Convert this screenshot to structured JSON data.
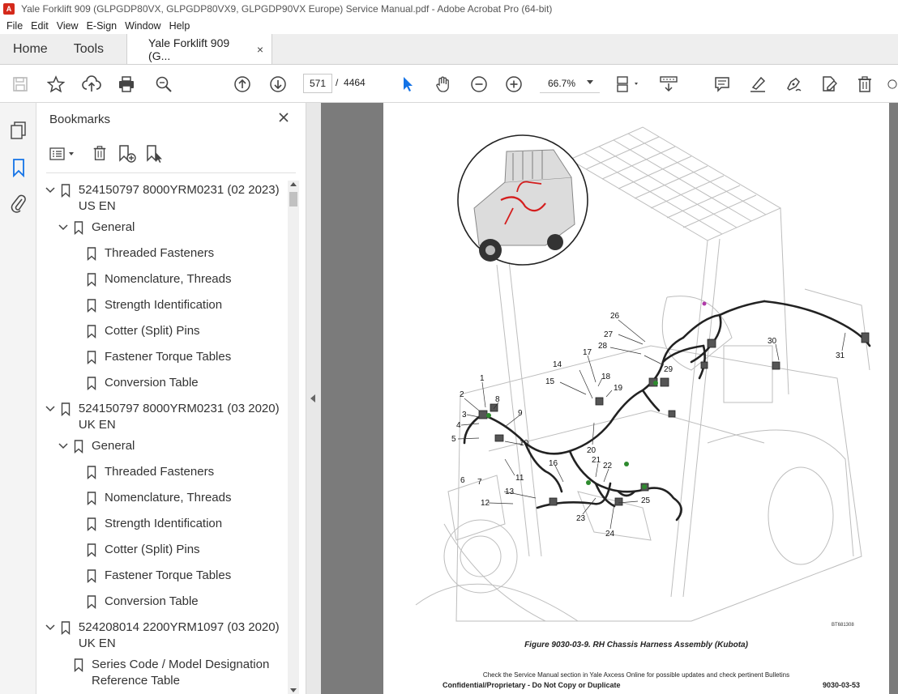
{
  "window": {
    "title": "Yale Forklift 909 (GLPGDP80VX, GLPGDP80VX9, GLPGDP90VX Europe) Service Manual.pdf - Adobe Acrobat Pro (64-bit)"
  },
  "menu": [
    "File",
    "Edit",
    "View",
    "E-Sign",
    "Window",
    "Help"
  ],
  "tabs": {
    "home": "Home",
    "tools": "Tools",
    "document": "Yale Forklift 909 (G...",
    "close": "×"
  },
  "toolbar": {
    "current_page": "571",
    "page_separator": "/",
    "total_pages": "4464",
    "zoom": "66.7%"
  },
  "bookmarks": {
    "title": "Bookmarks",
    "items": [
      {
        "label": "524150797 8000YRM0231 (02 2023) US EN",
        "level": 0,
        "expanded": true
      },
      {
        "label": "General",
        "level": 1,
        "expanded": true
      },
      {
        "label": "Threaded Fasteners",
        "level": 2
      },
      {
        "label": "Nomenclature, Threads",
        "level": 2
      },
      {
        "label": "Strength Identification",
        "level": 2
      },
      {
        "label": "Cotter (Split) Pins",
        "level": 2
      },
      {
        "label": "Fastener Torque Tables",
        "level": 2
      },
      {
        "label": "Conversion Table",
        "level": 2
      },
      {
        "label": "524150797 8000YRM0231 (03 2020) UK EN",
        "level": 0,
        "expanded": true
      },
      {
        "label": "General",
        "level": 1,
        "expanded": true
      },
      {
        "label": "Threaded Fasteners",
        "level": 2
      },
      {
        "label": "Nomenclature, Threads",
        "level": 2
      },
      {
        "label": "Strength Identification",
        "level": 2
      },
      {
        "label": "Cotter (Split) Pins",
        "level": 2
      },
      {
        "label": "Fastener Torque Tables",
        "level": 2
      },
      {
        "label": "Conversion Table",
        "level": 2
      },
      {
        "label": "524208014 2200YRM1097 (03 2020) UK EN",
        "level": 0,
        "expanded": true
      },
      {
        "label": "Series Code / Model Designation Reference Table",
        "level": 1
      }
    ]
  },
  "document_page": {
    "figure_caption": "Figure 9030-03-9. RH Chassis Harness Assembly (Kubota)",
    "figure_id": "BT681308",
    "footnote": "Check the Service Manual section in Yale Axcess Online for possible updates and check pertinent Bulletins",
    "confidential": "Confidential/Proprietary - Do Not Copy or Duplicate",
    "page_number": "9030-03-53",
    "callouts": [
      "1",
      "2",
      "3",
      "4",
      "5",
      "6",
      "7",
      "8",
      "9",
      "10",
      "11",
      "12",
      "13",
      "14",
      "15",
      "16",
      "17",
      "18",
      "19",
      "20",
      "21",
      "22",
      "23",
      "24",
      "25",
      "26",
      "27",
      "28",
      "29",
      "30",
      "31"
    ]
  },
  "colors": {
    "accent_blue": "#1473e6",
    "harness_red": "#d41e1e"
  }
}
